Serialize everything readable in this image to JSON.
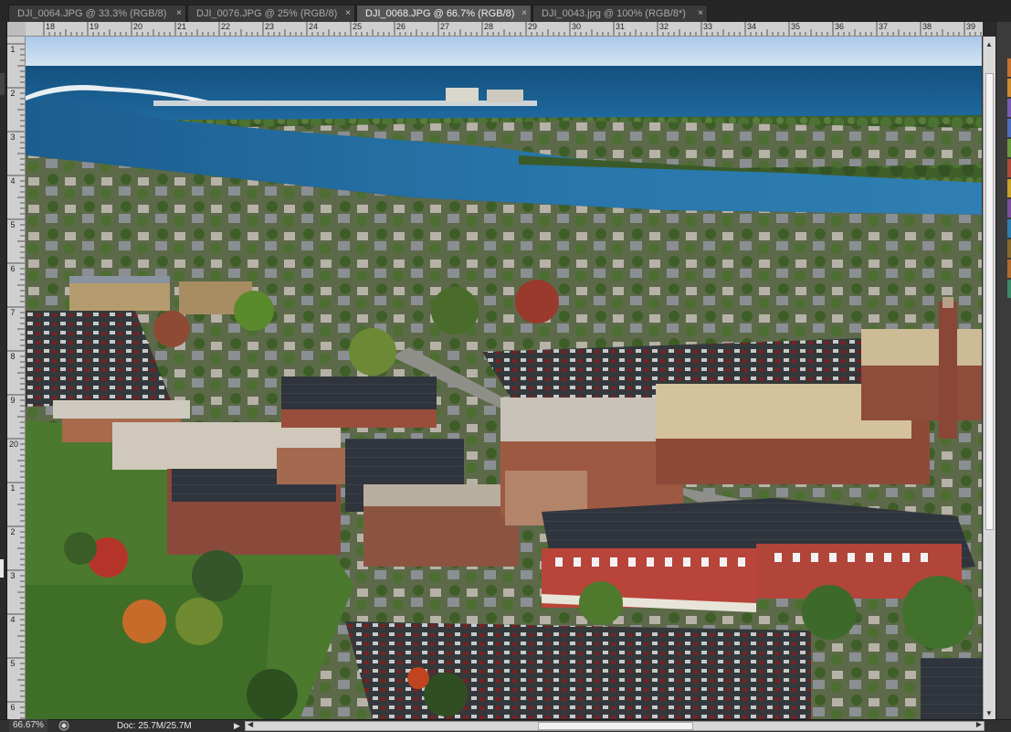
{
  "tabs": [
    {
      "label": "DJI_0064.JPG @ 33.3% (RGB/8)",
      "close": "×"
    },
    {
      "label": "DJI_0076.JPG @ 25% (RGB/8)",
      "close": "×"
    },
    {
      "label": "DJI_0068.JPG @ 66.7% (RGB/8)",
      "close": "×"
    },
    {
      "label": "DJI_0043.jpg @ 100% (RGB/8*)",
      "close": "×"
    }
  ],
  "active_tab": 2,
  "ruler": {
    "top": [
      "18",
      "19",
      "20",
      "21",
      "22",
      "23",
      "24",
      "25",
      "26",
      "27",
      "28",
      "29",
      "30",
      "31",
      "32",
      "33",
      "34",
      "35",
      "36",
      "37",
      "38",
      "39"
    ],
    "left": [
      "1",
      "2",
      "3",
      "4",
      "5",
      "6",
      "7",
      "8",
      "9",
      "20",
      "1",
      "2",
      "3",
      "4",
      "5",
      "6"
    ]
  },
  "status": {
    "zoom": "66.67%",
    "doc": "Doc: 25.7M/25.7M",
    "arrow": "▶"
  },
  "scroll": {
    "up": "▲",
    "down": "▼",
    "left": "◀",
    "right": "▶"
  },
  "colors": {
    "swatches": [
      "#c9722f",
      "#d08a2e",
      "#7a5bb5",
      "#4f6fc0",
      "#6b9a3c",
      "#b44b3a",
      "#c9a227",
      "#7b4f9e",
      "#2f7fb3",
      "#8a6a2a",
      "#b46b2e",
      "#3f8a6a"
    ]
  },
  "canvas_image": {
    "description_icon": "aerial-photo"
  }
}
